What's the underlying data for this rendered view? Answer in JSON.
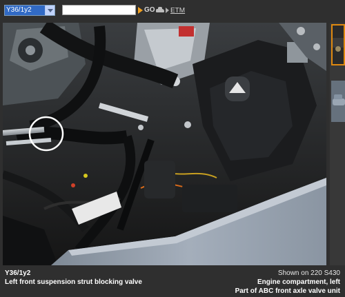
{
  "toolbar": {
    "component_select": {
      "value": "Y36/1y2"
    },
    "search": {
      "value": "",
      "placeholder": ""
    },
    "go_button": {
      "label": "GO",
      "icon": "orange-arrow-icon",
      "car_icon": "car-icon"
    },
    "etm_link": {
      "label": "ETM"
    }
  },
  "photo": {
    "description_icon": "engine-photo",
    "highlight_marker": "circle-marker"
  },
  "caption": {
    "code": "Y36/1y2",
    "name": "Left front suspension strut blocking valve",
    "shown_on": "Shown on 220 S430",
    "location": "Engine compartment, left",
    "part_of": "Part of ABC front axle valve unit"
  },
  "colors": {
    "background": "#2f2f2f",
    "accent": "#f0a020",
    "selection": "#316ac5",
    "body_panel": "#8f9aa6"
  }
}
